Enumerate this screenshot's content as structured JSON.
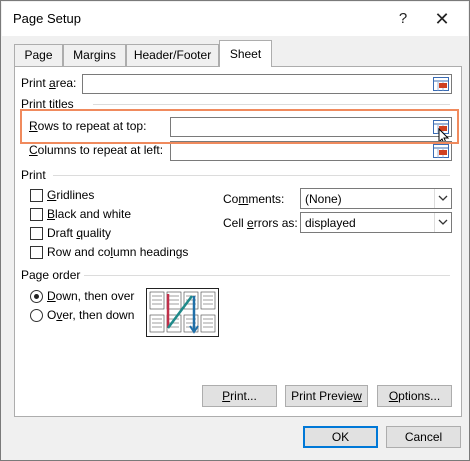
{
  "window": {
    "title": "Page Setup",
    "help": "?",
    "close": "✕"
  },
  "tabs": [
    {
      "label": "Page"
    },
    {
      "label": "Margins"
    },
    {
      "label": "Header/Footer"
    },
    {
      "label": "Sheet"
    }
  ],
  "print_area": {
    "label_pre": "Print ",
    "label_u": "a",
    "label_post": "rea:",
    "value": ""
  },
  "print_titles": {
    "heading": "Print titles",
    "rows": {
      "label_u": "R",
      "label_post": "ows to repeat at top:",
      "value": ""
    },
    "columns": {
      "label_u": "C",
      "label_post": "olumns to repeat at left:",
      "value": ""
    }
  },
  "print": {
    "heading": "Print",
    "gridlines": {
      "label_u": "G",
      "label_post": "ridlines",
      "checked": false
    },
    "black_white": {
      "label_u": "B",
      "label_post": "lack and white",
      "checked": false
    },
    "draft": {
      "label_pre": "Draft ",
      "label_u": "q",
      "label_post": "uality",
      "checked": false
    },
    "headings": {
      "label_pre": "Row and co",
      "label_u": "l",
      "label_post": "umn headings",
      "checked": false
    },
    "comments": {
      "label_pre": "Co",
      "label_u": "m",
      "label_post": "ments:",
      "value": "(None)"
    },
    "cell_errors": {
      "label_pre": "Cell ",
      "label_u": "e",
      "label_post": "rrors as:",
      "value": "displayed"
    }
  },
  "page_order": {
    "heading": "Page order",
    "down_over": {
      "label_u": "D",
      "label_post": "own, then over",
      "selected": true
    },
    "over_down": {
      "label_pre": "O",
      "label_u": "v",
      "label_post": "er, then down",
      "selected": false
    }
  },
  "buttons": {
    "print": {
      "label_pre": "",
      "label_u": "P",
      "label_post": "rint..."
    },
    "preview": {
      "label_pre": "Print Previe",
      "label_u": "w",
      "label_post": ""
    },
    "options": {
      "label_pre": "",
      "label_u": "O",
      "label_post": "ptions..."
    },
    "ok": "OK",
    "cancel": "Cancel"
  },
  "colors": {
    "highlight": "#f08a5d",
    "accent": "#0078d7"
  }
}
